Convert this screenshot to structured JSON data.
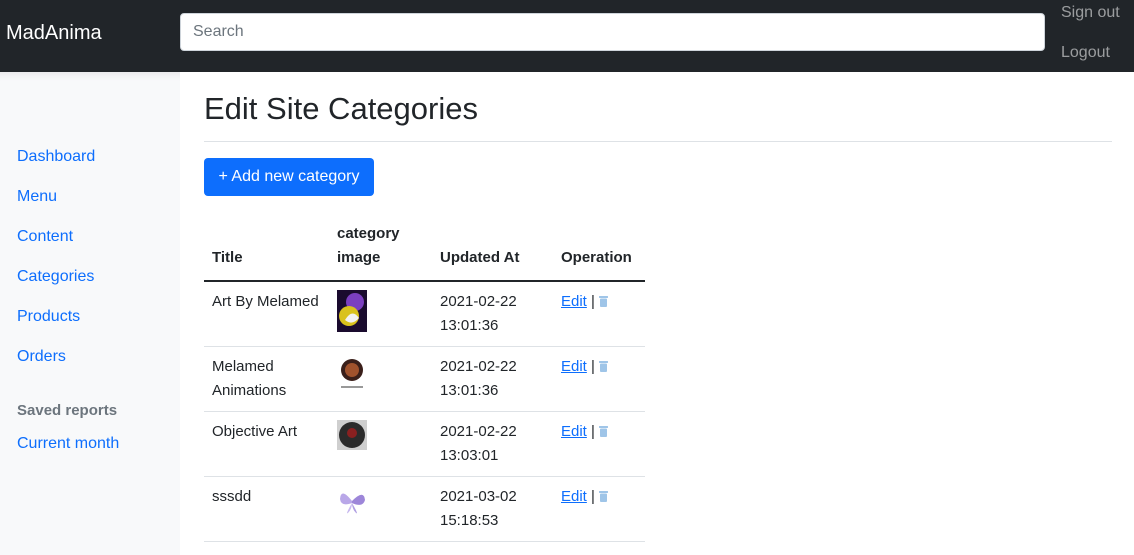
{
  "header": {
    "brand": "MadAnima",
    "search_placeholder": "Search",
    "signout_label": "Sign out",
    "logout_label": "Logout",
    "bg_color": "#212529"
  },
  "sidebar": {
    "items": [
      {
        "label": "Dashboard"
      },
      {
        "label": "Menu"
      },
      {
        "label": "Content"
      },
      {
        "label": "Categories"
      },
      {
        "label": "Products"
      },
      {
        "label": "Orders"
      }
    ],
    "saved_reports_heading": "Saved reports",
    "saved_items": [
      {
        "label": "Current month"
      }
    ]
  },
  "main": {
    "title": "Edit Site Categories",
    "add_button_label": "+ Add new category",
    "accent_color": "#0d6efd"
  },
  "table": {
    "headers": [
      "Title",
      "category image",
      "Updated At",
      "Operation"
    ],
    "rows": [
      {
        "title": "Art By Melamed",
        "image_icon": "purple-yellow-art-thumbnail",
        "updated": "2021-02-22 13:01:36",
        "edit_label": "Edit",
        "separator": "|",
        "delete_icon": "trash-icon"
      },
      {
        "title": "Melamed Animations",
        "image_icon": "round-logo-thumbnail",
        "updated": "2021-02-22 13:01:36",
        "edit_label": "Edit",
        "separator": "|",
        "delete_icon": "trash-icon"
      },
      {
        "title": "Objective Art",
        "image_icon": "dark-orb-thumbnail",
        "updated": "2021-02-22 13:03:01",
        "edit_label": "Edit",
        "separator": "|",
        "delete_icon": "trash-icon"
      },
      {
        "title": "sssdd",
        "image_icon": "butterfly-thumbnail",
        "updated": "2021-03-02 15:18:53",
        "edit_label": "Edit",
        "separator": "|",
        "delete_icon": "trash-icon"
      }
    ]
  }
}
